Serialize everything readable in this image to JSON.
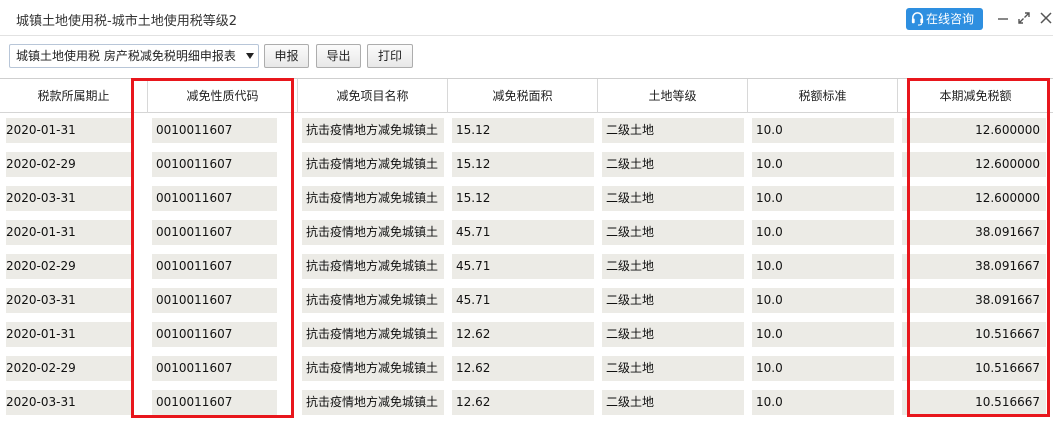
{
  "window": {
    "title": "城镇土地使用税-城市土地使用税等级2",
    "consult_label": "在线咨询"
  },
  "toolbar": {
    "report_select_value": "城镇土地使用税 房产税减免税明细申报表",
    "declare_label": "申报",
    "export_label": "导出",
    "print_label": "打印"
  },
  "table": {
    "headers": [
      "税款所属期止",
      "减免性质代码",
      "减免项目名称",
      "减免税面积",
      "土地等级",
      "税额标准",
      "本期减免税额"
    ],
    "rows": [
      [
        "2020-01-31",
        "0010011607",
        "抗击疫情地方减免城镇土",
        "15.12",
        "二级土地",
        "10.0",
        "12.600000"
      ],
      [
        "2020-02-29",
        "0010011607",
        "抗击疫情地方减免城镇土",
        "15.12",
        "二级土地",
        "10.0",
        "12.600000"
      ],
      [
        "2020-03-31",
        "0010011607",
        "抗击疫情地方减免城镇土",
        "15.12",
        "二级土地",
        "10.0",
        "12.600000"
      ],
      [
        "2020-01-31",
        "0010011607",
        "抗击疫情地方减免城镇土",
        "45.71",
        "二级土地",
        "10.0",
        "38.091667"
      ],
      [
        "2020-02-29",
        "0010011607",
        "抗击疫情地方减免城镇土",
        "45.71",
        "二级土地",
        "10.0",
        "38.091667"
      ],
      [
        "2020-03-31",
        "0010011607",
        "抗击疫情地方减免城镇土",
        "45.71",
        "二级土地",
        "10.0",
        "38.091667"
      ],
      [
        "2020-01-31",
        "0010011607",
        "抗击疫情地方减免城镇土",
        "12.62",
        "二级土地",
        "10.0",
        "10.516667"
      ],
      [
        "2020-02-29",
        "0010011607",
        "抗击疫情地方减免城镇土",
        "12.62",
        "二级土地",
        "10.0",
        "10.516667"
      ],
      [
        "2020-03-31",
        "0010011607",
        "抗击疫情地方减免城镇土",
        "12.62",
        "二级土地",
        "10.0",
        "10.516667"
      ]
    ]
  },
  "colors": {
    "accent": "#2e8fe0",
    "highlight": "#e8161c",
    "cell_bg": "#ecebe6"
  }
}
